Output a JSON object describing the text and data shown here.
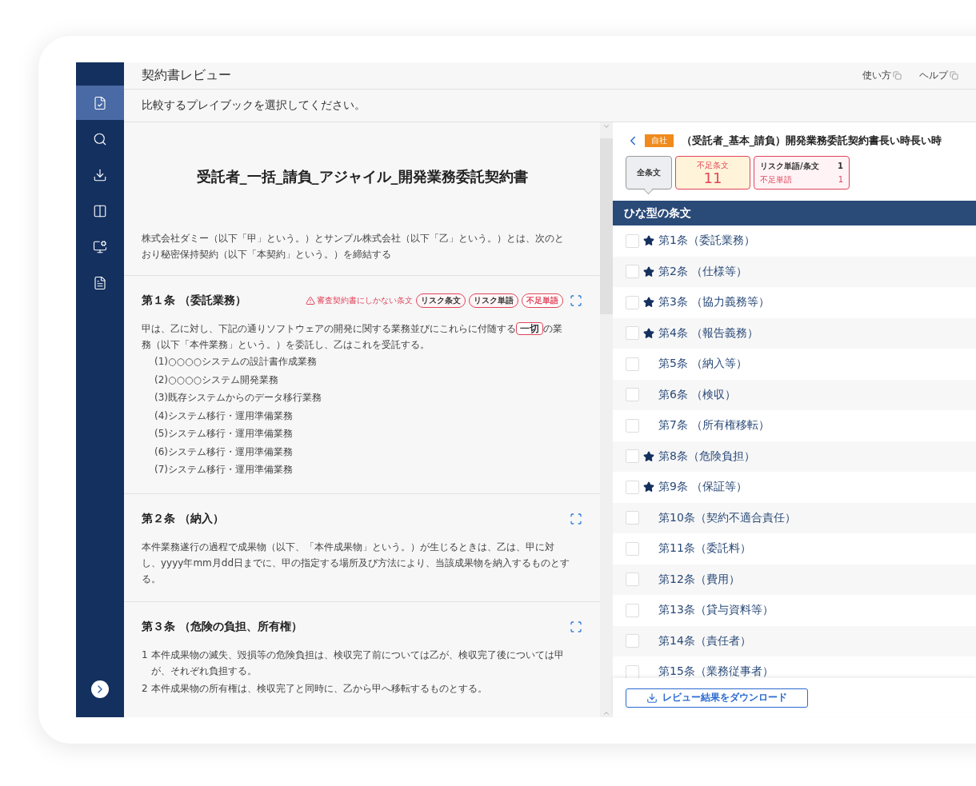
{
  "header": {
    "title": "契約書レビュー",
    "links": [
      {
        "label": "使い方"
      },
      {
        "label": "ヘルプ"
      }
    ]
  },
  "sidebar": {
    "items": [
      {
        "kind": "review",
        "selected": true
      },
      {
        "kind": "search",
        "selected": false
      },
      {
        "kind": "download",
        "selected": false
      },
      {
        "kind": "compare",
        "selected": false
      },
      {
        "kind": "settings",
        "selected": false
      },
      {
        "kind": "document",
        "selected": false
      }
    ]
  },
  "prompt": "比較するプレイブックを選択してください。",
  "document": {
    "title": "受託者_一括_請負_アジャイル_開発業務委託契約書",
    "intro": "株式会社ダミー（以下「甲」という。）とサンプル株式会社（以下「乙」という。）とは、次のとおり秘密保持契約（以下「本契約」という。）を締結する",
    "articles": [
      {
        "heading": "第１条 （委託業務）",
        "warning": "審査契約書にしかない条文",
        "tags": [
          {
            "kind": "risk",
            "label": "リスク条文"
          },
          {
            "kind": "risk",
            "label": "リスク単語"
          },
          {
            "kind": "missing",
            "label": "不足単語"
          }
        ],
        "body": [
          {
            "kind": "text",
            "text": "甲は、乙に対し、下記の通りソフトウェアの開発に関する業務並びにこれらに付随する"
          },
          {
            "kind": "mark",
            "text": "一切"
          },
          {
            "kind": "text",
            "text": "の業務（以下「本件業務」という。）を委託し、乙はこれを受託する。"
          }
        ],
        "items": [
          {
            "kind": "sub",
            "text": "(1)○○○○システムの設計書作成業務"
          },
          {
            "kind": "sub",
            "text": "(2)○○○○システム開発業務"
          },
          {
            "kind": "sub",
            "text": "(3)既存システムからのデータ移行業務"
          },
          {
            "kind": "sub",
            "text": "(4)システム移行・運用準備業務"
          },
          {
            "kind": "sub",
            "text": "(5)システム移行・運用準備業務"
          },
          {
            "kind": "sub",
            "text": "(6)システム移行・運用準備業務"
          },
          {
            "kind": "sub",
            "text": "(7)システム移行・運用準備業務"
          }
        ]
      },
      {
        "heading": "第２条 （納入）",
        "body": [
          {
            "kind": "text",
            "text": "本件業務遂行の過程で成果物（以下、「本件成果物」という。）が生じるときは、乙は、甲に対し、yyyy年mm月dd日までに、甲の指定する場所及び方法により、当該成果物を納入するものとする。"
          }
        ]
      },
      {
        "heading": "第３条 （危険の負担、所有権）",
        "items": [
          {
            "kind": "numbered",
            "number": "1",
            "text": "本件成果物の滅失、毀損等の危険負担は、検収完了前については乙が、検収完了後については甲が、それぞれ負担する。"
          },
          {
            "kind": "numbered",
            "number": "2",
            "text": "本件成果物の所有権は、検収完了と同時に、乙から甲へ移転するものとする。"
          }
        ]
      }
    ]
  },
  "review": {
    "badge": "自社",
    "title": "（受託者_基本_請負）開発業務委託契約書長い時長い時",
    "filters": [
      {
        "kind": "all",
        "label": "全条文",
        "selected": true
      },
      {
        "kind": "missing",
        "label": "不足条文",
        "count": "11",
        "selected": false
      },
      {
        "kind": "risk",
        "selected": false,
        "rows": [
          {
            "kind": "risk",
            "label": "リスク単語/条文",
            "count": "1"
          },
          {
            "kind": "missing",
            "label": "不足単語",
            "count": "1"
          }
        ]
      }
    ],
    "section": "ひな型の条文",
    "clauses": [
      {
        "label": "第1条（委託業務）",
        "starred": true,
        "checked": false
      },
      {
        "label": "第2条 （仕様等）",
        "starred": true,
        "checked": false
      },
      {
        "label": "第3条 （協力義務等）",
        "starred": true,
        "checked": false
      },
      {
        "label": "第4条 （報告義務）",
        "starred": true,
        "checked": false
      },
      {
        "label": "第5条 （納入等）",
        "starred": false,
        "checked": false
      },
      {
        "label": "第6条 （検収）",
        "starred": false,
        "checked": false
      },
      {
        "label": "第7条 （所有権移転）",
        "starred": false,
        "checked": false
      },
      {
        "label": "第8条（危険負担）",
        "starred": true,
        "checked": false
      },
      {
        "label": "第9条 （保証等）",
        "starred": true,
        "checked": false
      },
      {
        "label": "第10条（契約不適合責任）",
        "starred": false,
        "checked": false
      },
      {
        "label": "第11条（委託料）",
        "starred": false,
        "checked": false
      },
      {
        "label": "第12条（費用）",
        "starred": false,
        "checked": false
      },
      {
        "label": "第13条（貸与資料等）",
        "starred": false,
        "checked": false
      },
      {
        "label": "第14条（責任者）",
        "starred": false,
        "checked": false
      },
      {
        "label": "第15条（業務従事者）",
        "starred": false,
        "checked": false
      }
    ],
    "download": "レビュー結果をダウンロード"
  }
}
